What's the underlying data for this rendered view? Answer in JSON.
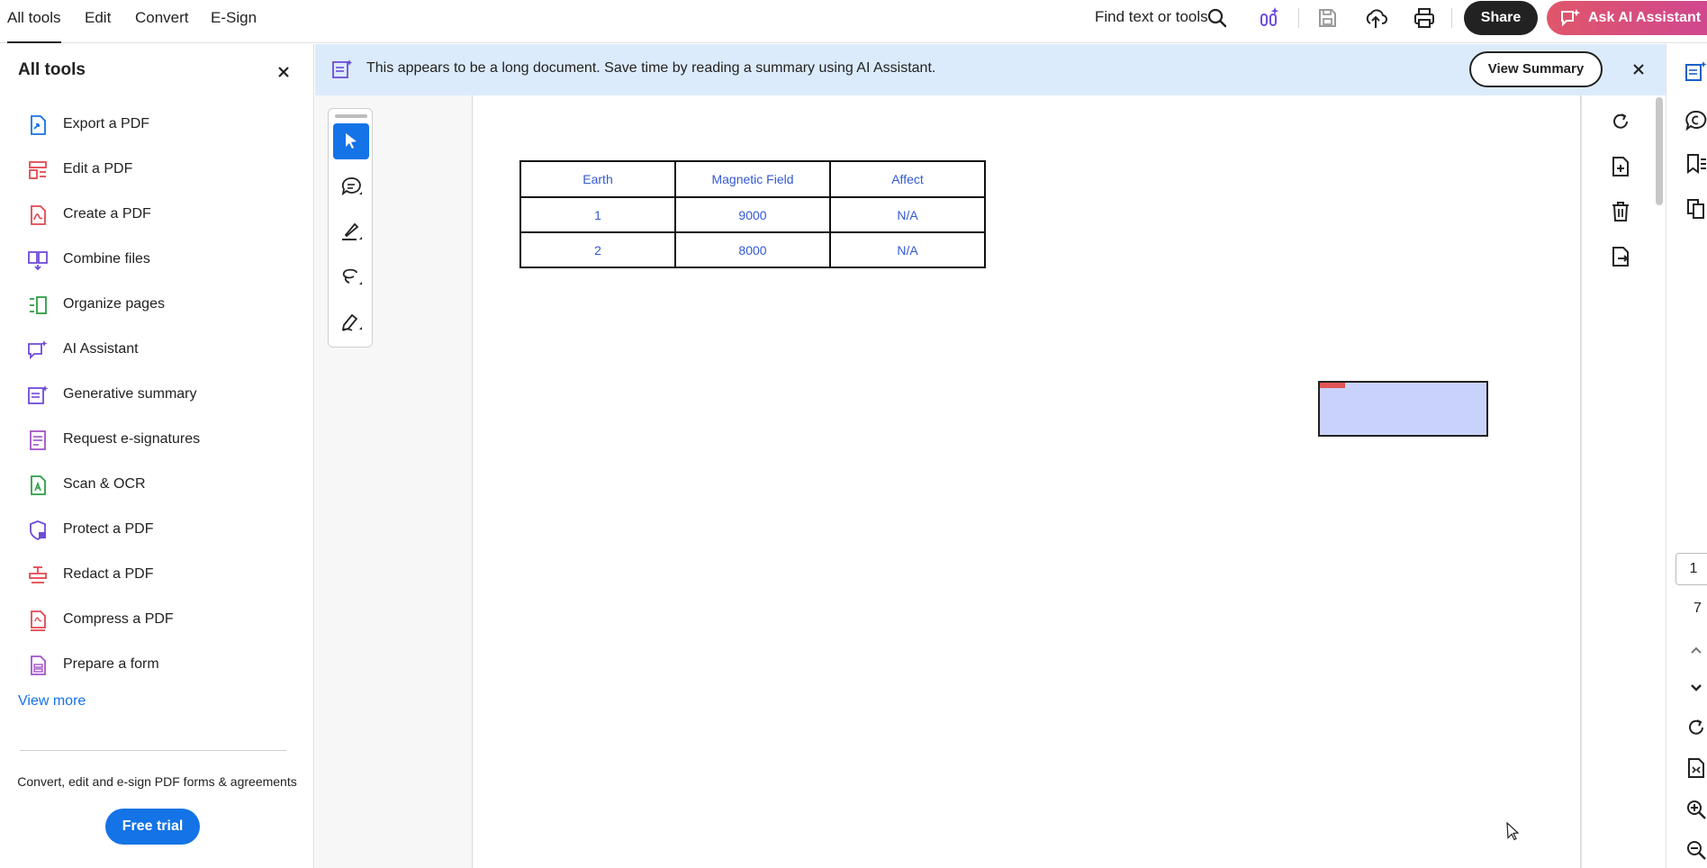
{
  "topbar": {
    "tabs": [
      {
        "label": "All tools"
      },
      {
        "label": "Edit"
      },
      {
        "label": "Convert"
      },
      {
        "label": "E-Sign"
      }
    ],
    "find_text": "Find text or tools",
    "share_label": "Share",
    "ask_ai_label": "Ask AI Assistant"
  },
  "sidebar": {
    "title": "All tools",
    "items": [
      {
        "label": "Export a PDF",
        "icon": "export-pdf-icon",
        "color": "#1473e6"
      },
      {
        "label": "Edit a PDF",
        "icon": "edit-pdf-icon",
        "color": "#e34850"
      },
      {
        "label": "Create a PDF",
        "icon": "create-pdf-icon",
        "color": "#e34850"
      },
      {
        "label": "Combine files",
        "icon": "combine-files-icon",
        "color": "#6f4bd8"
      },
      {
        "label": "Organize pages",
        "icon": "organize-pages-icon",
        "color": "#2d9d46"
      },
      {
        "label": "AI Assistant",
        "icon": "ai-assistant-icon",
        "color": "#6f4bd8"
      },
      {
        "label": "Generative summary",
        "icon": "generative-summary-icon",
        "color": "#6f4bd8"
      },
      {
        "label": "Request e-signatures",
        "icon": "request-esignatures-icon",
        "color": "#a253c9"
      },
      {
        "label": "Scan & OCR",
        "icon": "scan-ocr-icon",
        "color": "#2d9d46"
      },
      {
        "label": "Protect a PDF",
        "icon": "protect-pdf-icon",
        "color": "#6f4bd8"
      },
      {
        "label": "Redact a PDF",
        "icon": "redact-pdf-icon",
        "color": "#e34850"
      },
      {
        "label": "Compress a PDF",
        "icon": "compress-pdf-icon",
        "color": "#e34850"
      },
      {
        "label": "Prepare a form",
        "icon": "prepare-form-icon",
        "color": "#a253c9"
      }
    ],
    "view_more": "View more",
    "promo_text": "Convert, edit and e-sign PDF forms & agreements",
    "free_trial": "Free trial"
  },
  "banner": {
    "text": "This appears to be a long document. Save time by reading a summary using AI Assistant.",
    "view_summary": "View Summary"
  },
  "document": {
    "table": {
      "headers": [
        "Earth",
        "Magnetic Field",
        "Affect"
      ],
      "rows": [
        [
          "1",
          "9000",
          "N/A"
        ],
        [
          "2",
          "8000",
          "N/A"
        ]
      ]
    }
  },
  "page_nav": {
    "current": "1",
    "total": "7"
  },
  "colors": {
    "accent": "#1473e6",
    "ai_gradient_start": "#e0566a",
    "ai_gradient_end": "#d0478f",
    "banner_bg": "#dcebfb",
    "table_text": "#3358d4",
    "comment_fill": "#c8d2fb"
  }
}
